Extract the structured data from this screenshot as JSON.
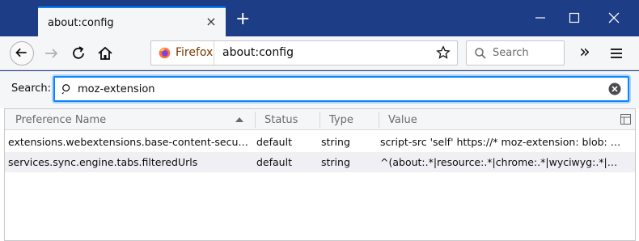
{
  "window": {
    "tab_title": "about:config",
    "close_tab_glyph": "×",
    "new_tab_glyph": "+"
  },
  "navbar": {
    "identity_label": "Firefox",
    "url": "about:config",
    "search_placeholder": "Search",
    "overflow_glyph": "»"
  },
  "filter": {
    "label": "Search:",
    "value": "moz-extension"
  },
  "table": {
    "columns": [
      "Preference Name",
      "Status",
      "Type",
      "Value"
    ],
    "rows": [
      {
        "name": "extensions.webextensions.base-content-security-policy",
        "status": "default",
        "type": "string",
        "value": "script-src 'self' https://* moz-extension: blob: filesystem: 'unsafe-eval' 'unsafe-inline'"
      },
      {
        "name": "services.sync.engine.tabs.filteredUrls",
        "status": "default",
        "type": "string",
        "value": "^(about:.*|resource:.*|chrome:.*|wyciwyg:.*|file:.*|blob:.*)$"
      }
    ]
  },
  "colors": {
    "titlebar": "#1d3d86",
    "accent": "#0a84ff",
    "toolbar": "#f5f6f7"
  }
}
